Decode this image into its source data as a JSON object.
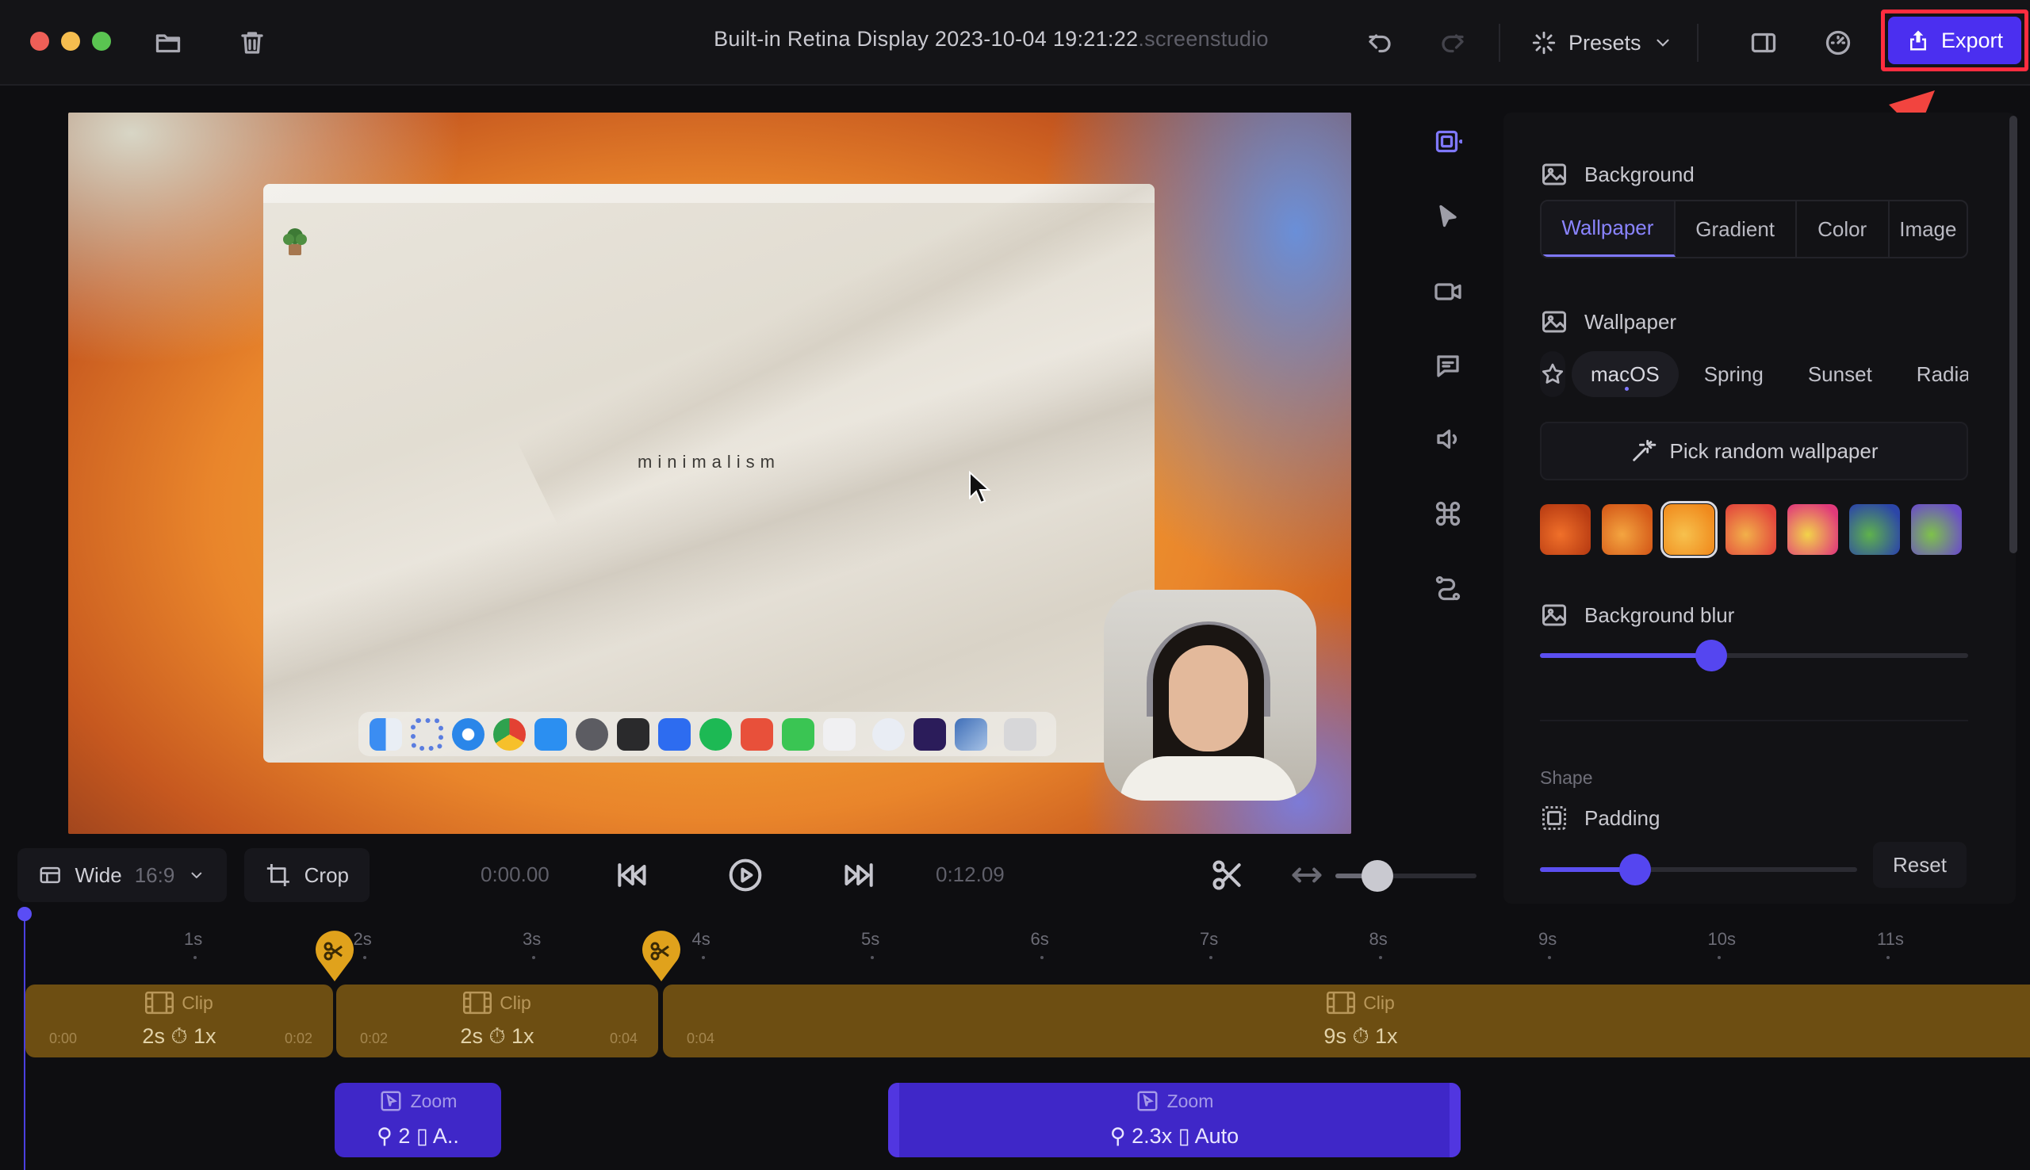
{
  "window": {
    "title": "Built-in Retina Display 2023-10-04 19:21:22",
    "title_ext": ".screenstudio",
    "presets_label": "Presets",
    "export_label": "Export"
  },
  "preview": {
    "desktop_text": "minimalism"
  },
  "panel": {
    "background_title": "Background",
    "tabs": [
      "Wallpaper",
      "Gradient",
      "Color",
      "Image"
    ],
    "active_tab": "Wallpaper",
    "wallpaper_title": "Wallpaper",
    "wallpaper_chips": [
      "macOS",
      "Spring",
      "Sunset",
      "Radia"
    ],
    "selected_chip": "macOS",
    "random_label": "Pick random wallpaper",
    "thumb_colors": [
      [
        "#b83b12",
        "#f0702a"
      ],
      [
        "#d45818",
        "#f4a540"
      ],
      [
        "#f08a1d",
        "#f7c14d"
      ],
      [
        "#e2443c",
        "#f2b04a"
      ],
      [
        "#e03a7a",
        "#f2d34a"
      ],
      [
        "#2c46a8",
        "#5fb24c"
      ],
      [
        "#6b4ec8",
        "#7ec24a"
      ]
    ],
    "selected_thumb": 2,
    "blur_title": "Background blur",
    "blur_value": 0.4,
    "shape_label": "Shape",
    "padding_title": "Padding",
    "padding_value": 0.3,
    "reset_label": "Reset"
  },
  "controls": {
    "aspect_label": "Wide",
    "aspect_ratio": "16:9",
    "crop_label": "Crop",
    "current_time": "0:00.00",
    "total_time": "0:12.09",
    "timeline_zoom": 0.3
  },
  "timeline": {
    "ticks": [
      "1s",
      "2s",
      "3s",
      "4s",
      "5s",
      "6s",
      "7s",
      "8s",
      "9s",
      "10s",
      "11s"
    ],
    "clips": [
      {
        "label": "Clip",
        "duration": "2s",
        "speed": "1x",
        "start": "0:00",
        "end": "0:02"
      },
      {
        "label": "Clip",
        "duration": "2s",
        "speed": "1x",
        "start": "0:02",
        "end": "0:04"
      },
      {
        "label": "Clip",
        "duration": "9s",
        "speed": "1x",
        "start": "0:04",
        "end": ""
      }
    ],
    "zooms": [
      {
        "label": "Zoom",
        "level": "2",
        "mode": "A.."
      },
      {
        "label": "Zoom",
        "level": "2.3x",
        "mode": "Auto"
      }
    ]
  },
  "colors": {
    "accent": "#4b2ff0",
    "highlight_border": "#ff2d3f",
    "clip": "#6d4e12",
    "zoom": "#3f27c8"
  }
}
